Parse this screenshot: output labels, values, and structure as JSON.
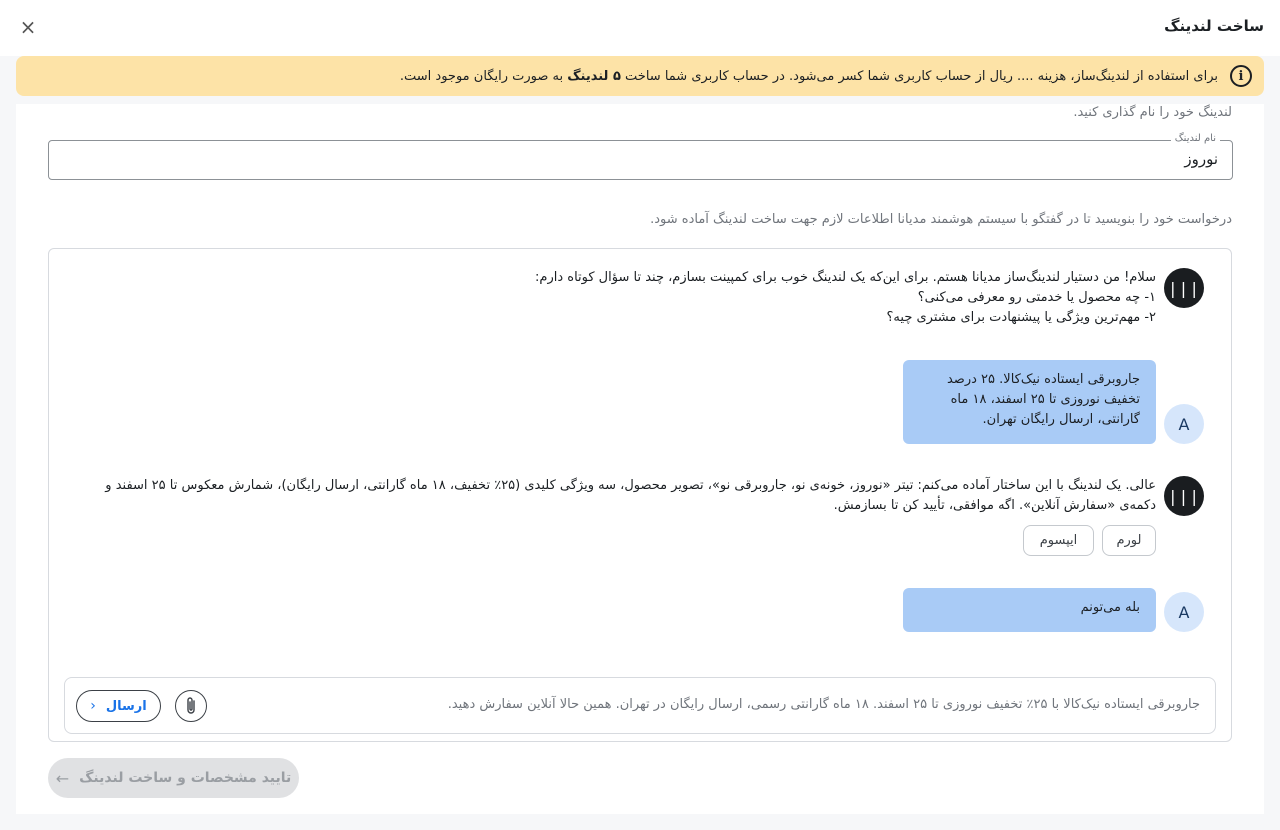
{
  "header": {
    "title": "ساخت لندینگ",
    "close_glyph": "×"
  },
  "banner": {
    "icon": "info-circle-icon",
    "text_before": "برای استفاده از لندینگ‌ساز، هزینه .... ریال از حساب کاربری شما کسر می‌شود. در حساب کاربری شما ساخت ",
    "text_bold": "۵ لندینگ",
    "text_after": " به صورت رایگان موجود است.",
    "background": "#fde3a7"
  },
  "form": {
    "name_hint": "لندینگ خود را نام گذاری کنید.",
    "name_label": "نام لندینگ",
    "name_value": "نوروز",
    "chat_hint": "درخواست خود را بنویسید تا در گفتگو با سیستم هوشمند مدیانا اطلاعات لازم جهت ساخت لندینگ آماده شود."
  },
  "chat": {
    "bot_avatar_text": "|||",
    "user_avatar_text": "A",
    "messages": [
      {
        "role": "bot",
        "lines": [
          "سلام! من دستیار لندینگ‌ساز مدیانا هستم. برای این‌که یک لندینگ خوب برای کمپینت بسازم، چند تا سؤال کوتاه دارم:",
          "۱- چه محصول یا خدمتی رو معرفی می‌کنی؟",
          "۲- مهم‌ترین ویژگی یا پیشنهادت برای مشتری چیه؟"
        ]
      },
      {
        "role": "user",
        "text": "جاروبرقی ایستاده نیک‌کالا. ۲۵ درصد تخفیف نوروزی تا ۲۵ اسفند، ۱۸ ماه گارانتی، ارسال رایگان تهران."
      },
      {
        "role": "bot",
        "lines": [
          "عالی. یک لندینگ با این ساختار آماده می‌کنم: تیتر «نوروز، خونه‌ی نو، جاروبرقی نو»، تصویر محصول، سه ویژگی کلیدی (۲۵٪ تخفیف، ۱۸ ماه گارانتی، ارسال رایگان)، شمارش معکوس تا ۲۵ اسفند و",
          "دکمه‌ی «سفارش آنلاین». اگه موافقی، تأیید کن تا بسازمش."
        ],
        "suggestions": [
          "لورم",
          "ایپسوم"
        ]
      },
      {
        "role": "user",
        "text": "بله می‌تونم"
      }
    ],
    "composer_text": "جاروبرقی ایستاده نیک‌کالا با ۲۵٪ تخفیف نوروزی تا ۲۵ اسفند. ۱۸ ماه گارانتی رسمی، ارسال رایگان در تهران. همین حالا آنلاین سفارش دهید.",
    "attach_icon": "paperclip-icon",
    "send_label": "ارسال",
    "send_icon": "chevron-right-icon"
  },
  "footer": {
    "confirm_label": "تایید مشخصات و ساخت لندینگ",
    "confirm_icon": "arrow-left-icon"
  },
  "colors": {
    "accent": "#1a73e8",
    "bot_avatar": "#1a1d20",
    "user_bubble": "#a9cbf6",
    "user_avatar": "#d6e6fb"
  }
}
